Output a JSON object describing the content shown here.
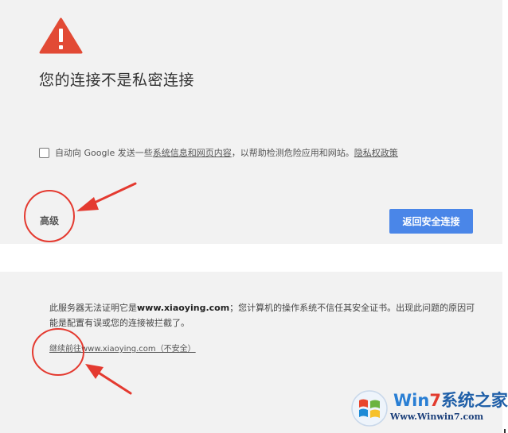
{
  "page": {
    "title": "您的连接不是私密连接",
    "report": {
      "text_before": "自动向 Google 发送一些",
      "link_info": "系统信息和网页内容",
      "text_after": "，以帮助检测危险应用和网站。",
      "link_privacy": "隐私权政策"
    },
    "advanced_label": "高级",
    "back_button_label": "返回安全连接",
    "details": {
      "text_start": "此服务器无法证明它是",
      "domain": "www.xiaoying.com",
      "text_end": "；您计算机的操作系统不信任其安全证书。出现此问题的原因可能是配置有误或您的连接被拦截了。",
      "proceed_link": "继续前往www.xiaoying.com（不安全）"
    }
  },
  "watermark": {
    "brand_prefix": "Win",
    "brand_digit": "7",
    "brand_suffix": "系统之家",
    "url": "Www.Winwin7.com"
  },
  "colors": {
    "background": "#f2f2f2",
    "warning_red": "#e24a35",
    "button_blue": "#4a86e8",
    "annotation_red": "#e43a30"
  },
  "icons": {
    "warning": "warning-triangle-icon",
    "checkbox": "checkbox-unchecked"
  }
}
